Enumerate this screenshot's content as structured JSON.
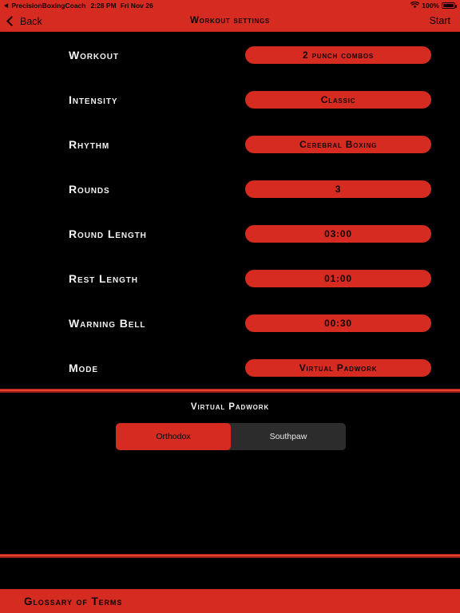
{
  "status_bar": {
    "back_app_glyph": "◀",
    "back_app_name": "PrecisionBoxingCoach",
    "time": "2:28 PM",
    "date": "Fri Nov 26",
    "wifi_icon": "wifi-icon",
    "battery_percent": "100%",
    "battery_icon": "battery-full-icon"
  },
  "nav_bar": {
    "back_label": "Back",
    "back_icon": "chevron-left-icon",
    "title": "Workout settings",
    "start_label": "Start"
  },
  "settings": {
    "rows": [
      {
        "label": "Workout",
        "value": "2 punch combos"
      },
      {
        "label": "Intensity",
        "value": "Classic"
      },
      {
        "label": "Rhythm",
        "value": "Cerebral Boxing"
      },
      {
        "label": "Rounds",
        "value": "3"
      },
      {
        "label": "Round Length",
        "value": "03:00"
      },
      {
        "label": "Rest Length",
        "value": "01:00"
      },
      {
        "label": "Warning Bell",
        "value": "00:30"
      },
      {
        "label": "Mode",
        "value": "Virtual Padwork"
      }
    ]
  },
  "padwork": {
    "title": "Virtual Padwork",
    "options": [
      {
        "label": "Orthodox",
        "selected": true
      },
      {
        "label": "Southpaw",
        "selected": false
      }
    ]
  },
  "glossary": {
    "label": "Glossary of Terms"
  },
  "colors": {
    "accent_red": "#D52B20",
    "divider_red": "#E8422F",
    "background": "#000000",
    "segment_unselected": "#2C2C2C",
    "label_text": "#F2F2F2",
    "on_red_text": "#140202"
  }
}
